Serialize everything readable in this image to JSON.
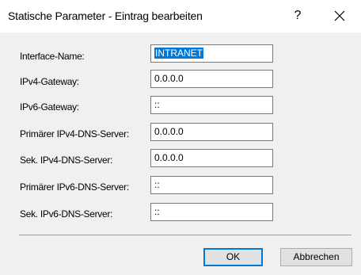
{
  "window": {
    "title": "Statische Parameter - Eintrag bearbeiten",
    "help_label": "?"
  },
  "form": {
    "fields": [
      {
        "label": "Interface-Name:",
        "value": "INTRANET",
        "selected": true
      },
      {
        "label": "IPv4-Gateway:",
        "value": "0.0.0.0"
      },
      {
        "label": "IPv6-Gateway:",
        "value": "::"
      },
      {
        "label": "Primärer IPv4-DNS-Server:",
        "value": "0.0.0.0"
      },
      {
        "label": "Sek. IPv4-DNS-Server:",
        "value": "0.0.0.0"
      },
      {
        "label": "Primärer IPv6-DNS-Server:",
        "value": "::"
      },
      {
        "label": "Sek. IPv6-DNS-Server:",
        "value": "::"
      }
    ]
  },
  "buttons": {
    "ok_label": "OK",
    "cancel_label": "Abbrechen"
  },
  "icons": {
    "close": "close-icon"
  }
}
